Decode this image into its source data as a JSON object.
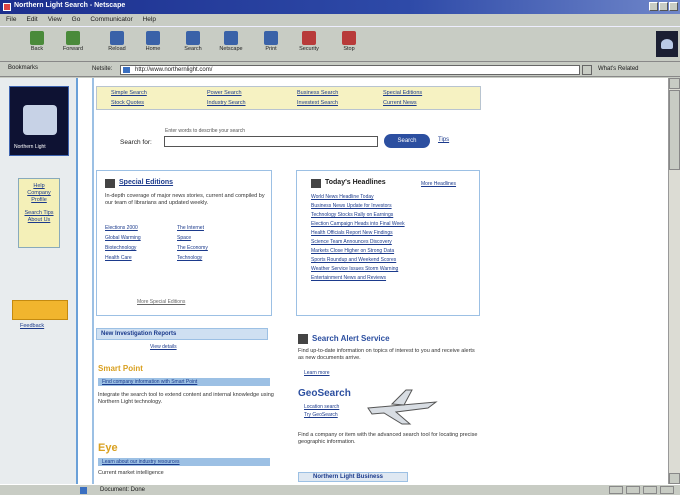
{
  "window": {
    "title": "Northern Light Search - Netscape"
  },
  "menu": [
    "File",
    "Edit",
    "View",
    "Go",
    "Communicator",
    "Help"
  ],
  "toolbar": [
    {
      "label": "Back",
      "color": "#4a8a3a"
    },
    {
      "label": "Forward",
      "color": "#4a8a3a"
    },
    {
      "label": "Reload",
      "color": "#3a62a8"
    },
    {
      "label": "Home",
      "color": "#3a62a8"
    },
    {
      "label": "Search",
      "color": "#3a62a8"
    },
    {
      "label": "Netscape",
      "color": "#3a62a8"
    },
    {
      "label": "Print",
      "color": "#3a62a8"
    },
    {
      "label": "Security",
      "color": "#b83a3a"
    },
    {
      "label": "Stop",
      "color": "#b83a3a"
    }
  ],
  "address": {
    "links_label": "Bookmarks",
    "location_label": "Netsite:",
    "url": "http://www.northernlight.com/",
    "related_label": "What's Related"
  },
  "leftnav": {
    "logo_caption": "Northern Light",
    "box_links": [
      "Help",
      "Company Profile",
      "Search Tips",
      "About Us"
    ],
    "bottom_link": "Feedback"
  },
  "topband": {
    "links": [
      "Simple Search",
      "Power Search",
      "Business Search",
      "Special Editions",
      "Stock Quotes",
      "Industry Search",
      "Investext Search",
      "Current News"
    ]
  },
  "search": {
    "hint": "Enter words to describe your search",
    "label": "Search for:",
    "button": "Search",
    "tips": "Tips"
  },
  "special": {
    "title": "Special Editions",
    "desc": "In-depth coverage of major news stories, current and compiled by our team of librarians and updated weekly.",
    "links": [
      "Elections 2000",
      "The Internet",
      "Global Warming",
      "Space",
      "Biotechnology",
      "The Economy",
      "Health Care",
      "Technology"
    ],
    "more": "More Special Editions"
  },
  "headlines": {
    "title": "Today's Headlines",
    "more": "More Headlines",
    "items": [
      "World News Headline Today",
      "Business News Update for Investors",
      "Technology Stocks Rally on Earnings",
      "Election Campaign Heads into Final Week",
      "Health Officials Report New Findings",
      "Science Team Announces Discovery",
      "Markets Close Higher on Strong Data",
      "Sports Roundup and Weekend Scores",
      "Weather Service Issues Storm Warning",
      "Entertainment News and Reviews"
    ]
  },
  "guide": {
    "title": "New Investigation Reports",
    "link": "View details"
  },
  "smartpoint": {
    "brand": "Smart Point",
    "link": "Find company information with Smart Point",
    "desc": "Integrate the search tool to extend content and internal knowledge using Northern Light technology."
  },
  "alert": {
    "title": "Search Alert Service",
    "desc": "Find up-to-date information on topics of interest to you and receive alerts as new documents arrive.",
    "link": "Learn more"
  },
  "geosearch": {
    "title": "GeoSearch",
    "links": [
      "Location search",
      "Try GeoSearch"
    ],
    "desc": "Find a company or item with the advanced search tool for locating precise geographic information."
  },
  "nextsect": {
    "brand": "Eye",
    "link": "Learn about our industry resources",
    "desc": "Current market intelligence"
  },
  "bottombox": "Northern Light Business",
  "status": {
    "text": "Document: Done"
  }
}
